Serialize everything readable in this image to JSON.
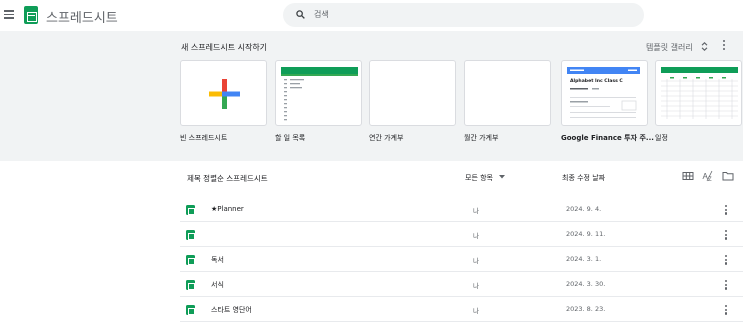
{
  "header": {
    "app_title": "스프레드시트",
    "search_placeholder": "검색"
  },
  "gallery": {
    "title": "새 스프레드시트 시작하기",
    "toggle_label": "템플릿 갤러리",
    "templates": [
      {
        "label": "빈 스프레드시트",
        "preview": "blank"
      },
      {
        "label": "할 일 목록",
        "preview": "todo"
      },
      {
        "label": "연간 가계부",
        "preview": "empty"
      },
      {
        "label": "월간 가계부",
        "preview": "empty"
      },
      {
        "label": "Google Finance 투자 주...",
        "preview": "finance",
        "preview_title": "Alphabet Inc Class C"
      },
      {
        "label": "일정",
        "preview": "schedule"
      }
    ]
  },
  "list": {
    "title_header": "제목 정렬순 스프레드시트",
    "owner_header": "모든 항목",
    "date_header": "최종 수정 날짜",
    "rows": [
      {
        "name": "★Planner",
        "owner": "나",
        "date": "2024. 9. 4."
      },
      {
        "name": "",
        "owner": "나",
        "date": "2024. 9. 11."
      },
      {
        "name": "독서",
        "owner": "나",
        "date": "2024. 3. 1."
      },
      {
        "name": "서식",
        "owner": "나",
        "date": "2024. 3. 30."
      },
      {
        "name": "스타트 영단어",
        "owner": "나",
        "date": "2023. 8. 23."
      }
    ]
  },
  "colors": {
    "brand_green": "#0f9d58",
    "gallery_bg": "#f1f3f4",
    "plus_blue": "#4285f4",
    "plus_red": "#ea4335",
    "plus_yellow": "#fbbc04",
    "plus_green": "#34a853"
  }
}
